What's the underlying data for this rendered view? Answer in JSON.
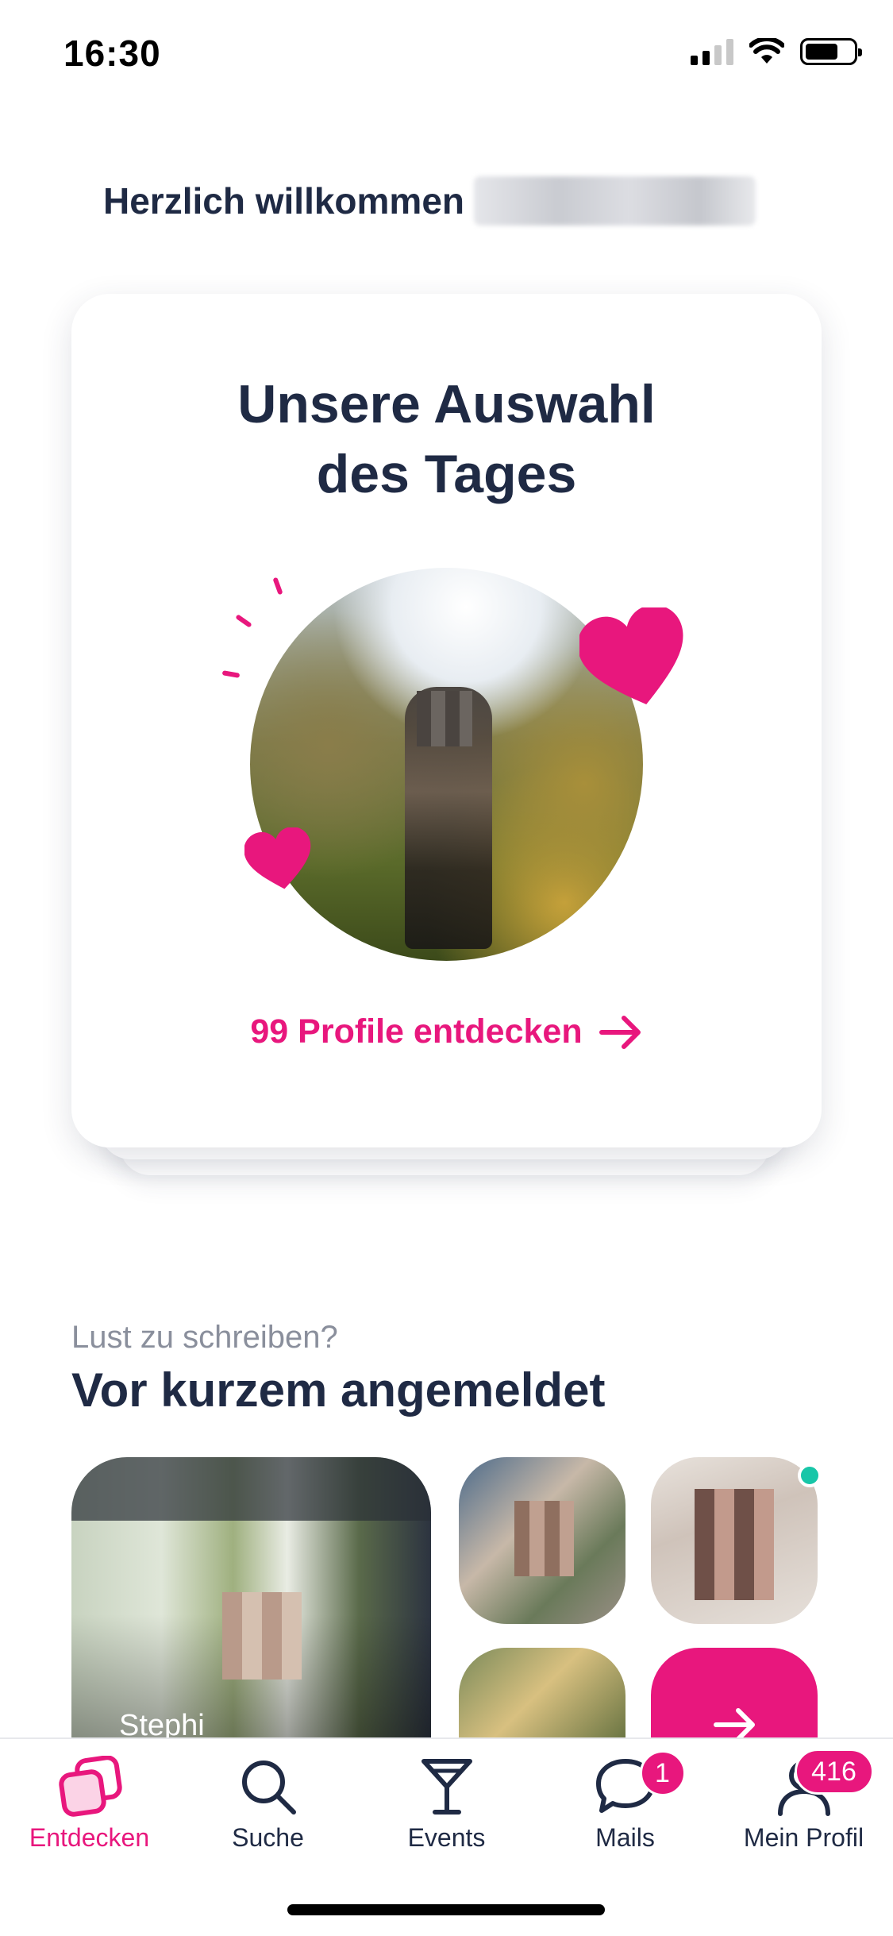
{
  "status_bar": {
    "time": "16:30"
  },
  "header": {
    "welcome": "Herzlich willkommen"
  },
  "daily_pick": {
    "title_line1": "Unsere Auswahl",
    "title_line2": "des Tages",
    "cta_label": "99 Profile entdecken"
  },
  "recent": {
    "subtitle": "Lust zu schreiben?",
    "title": "Vor kurzem angemeldet",
    "profiles": [
      {
        "name": "Stephi"
      }
    ]
  },
  "tabbar": {
    "items": [
      {
        "label": "Entdecken",
        "icon": "discover-icon",
        "active": true
      },
      {
        "label": "Suche",
        "icon": "search-icon"
      },
      {
        "label": "Events",
        "icon": "cocktail-icon"
      },
      {
        "label": "Mails",
        "icon": "chat-bubble-icon",
        "badge": "1"
      },
      {
        "label": "Mein Profil",
        "icon": "user-icon",
        "badge": "416"
      }
    ]
  },
  "colors": {
    "accent": "#e8177d",
    "text": "#1f2a44",
    "muted": "#8a8f9c",
    "online": "#18c6a8"
  }
}
